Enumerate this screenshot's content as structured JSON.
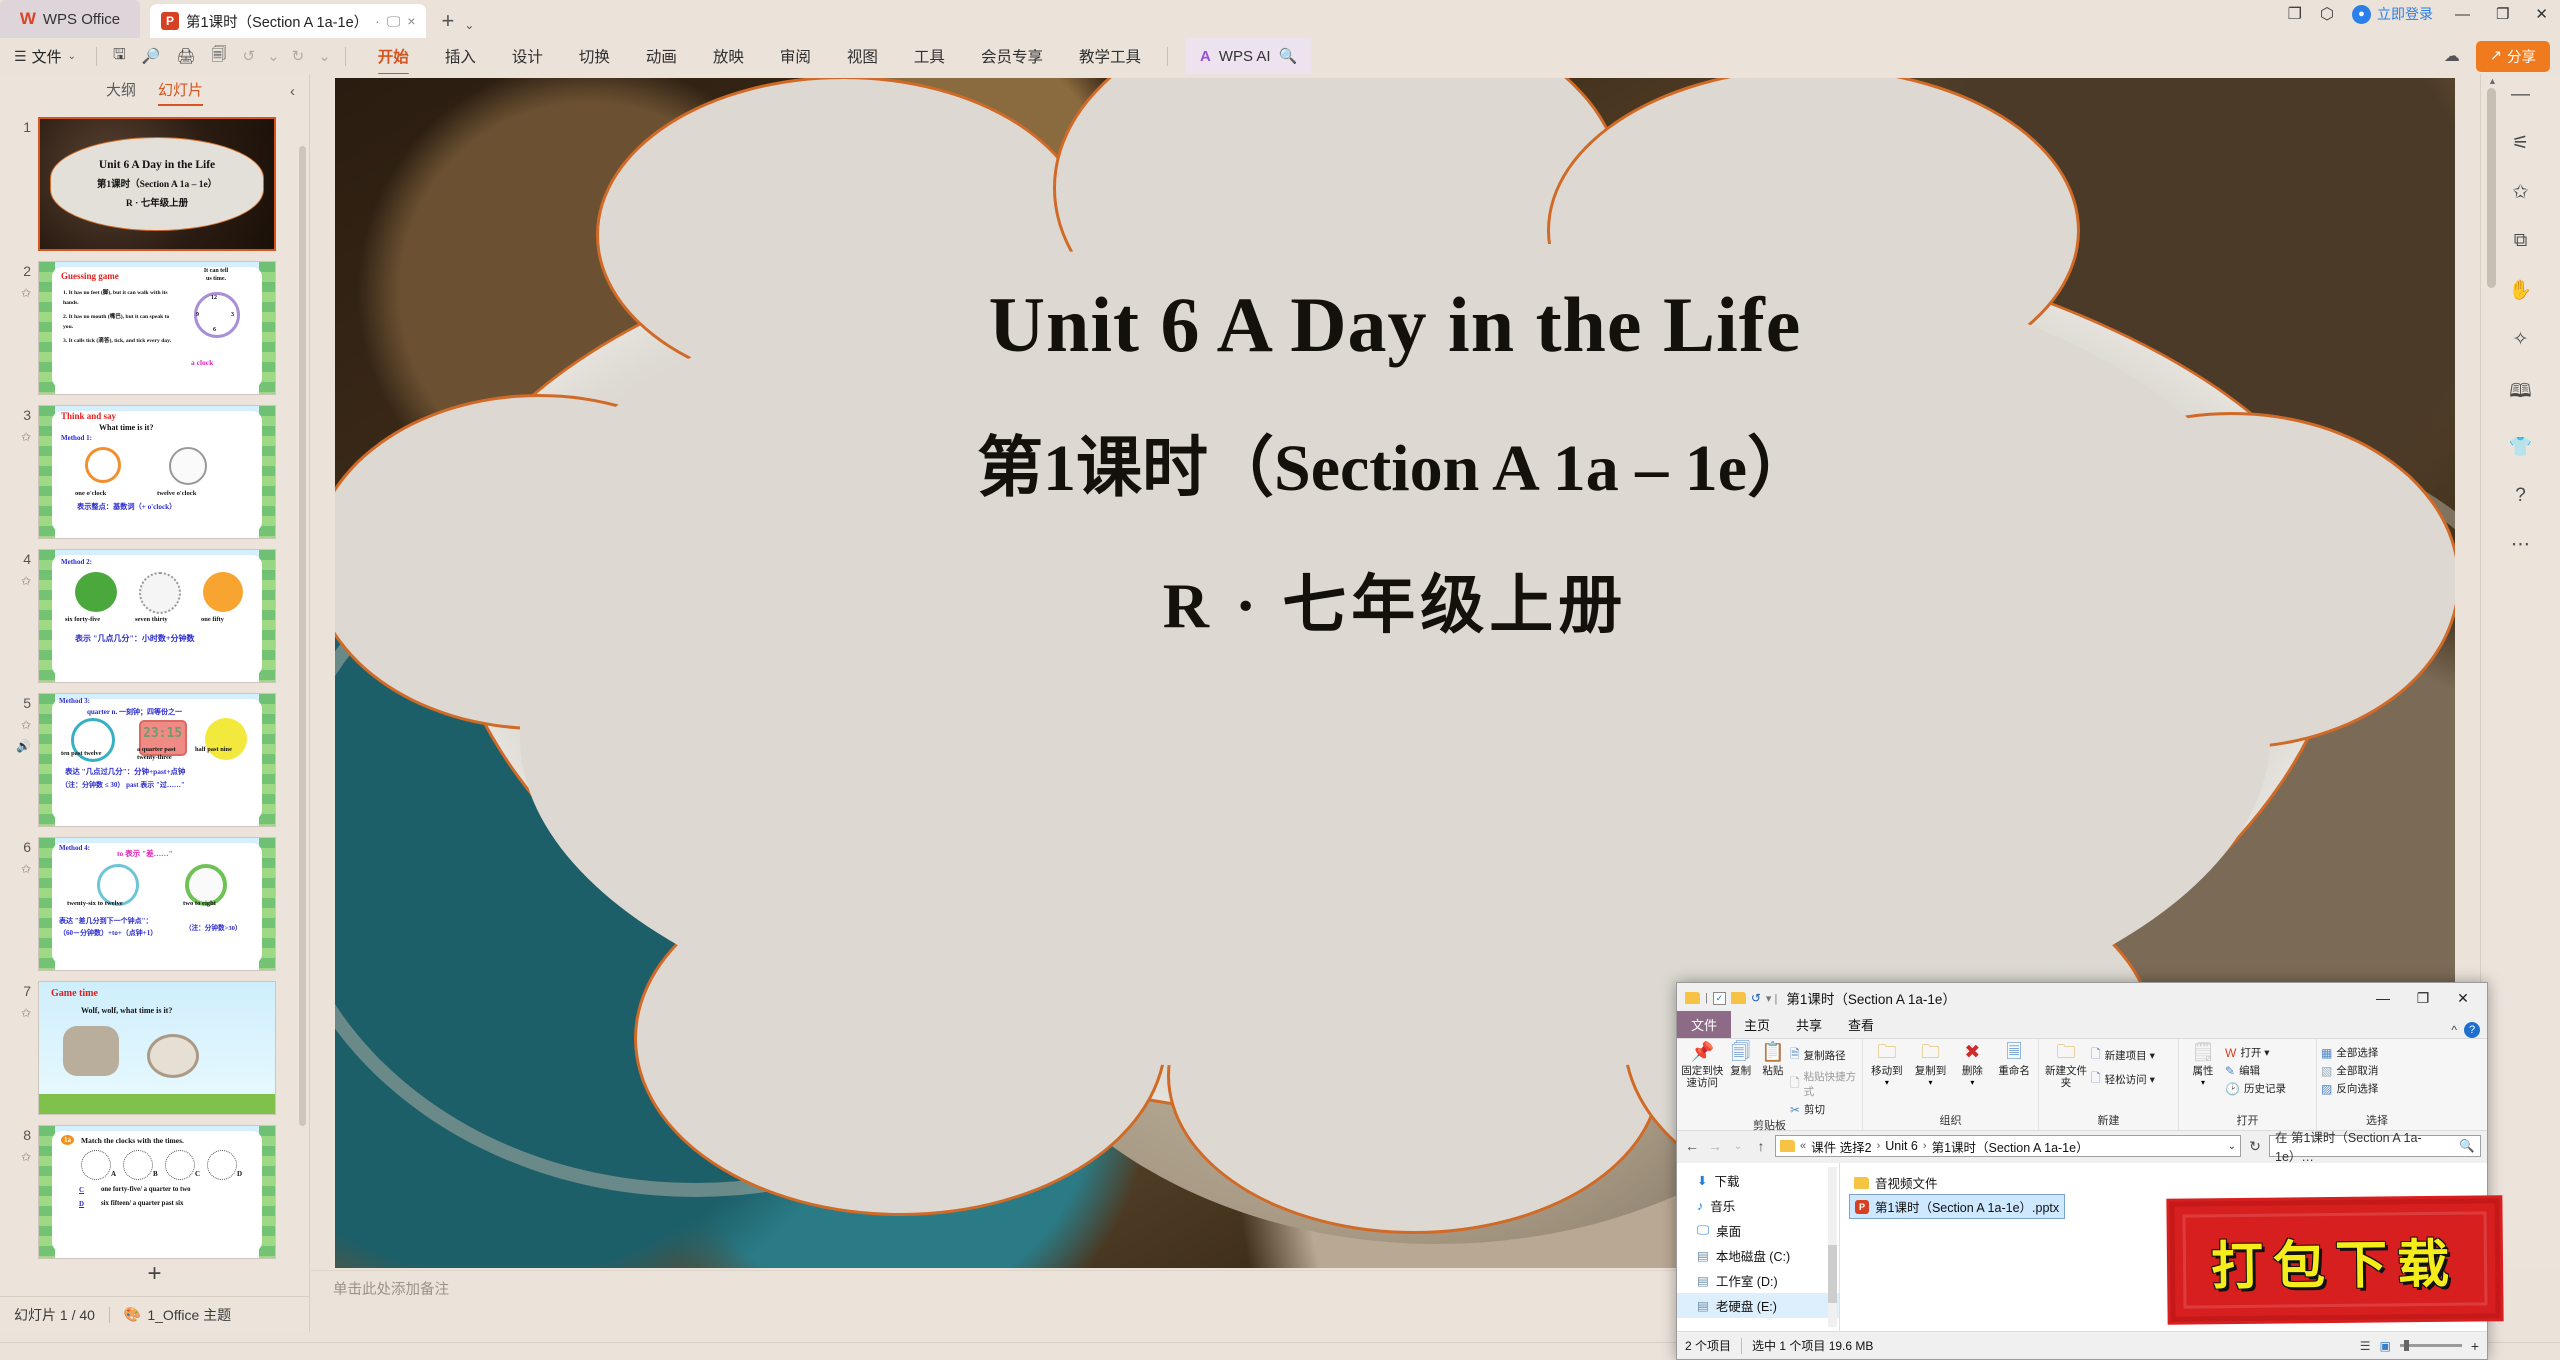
{
  "titlebar": {
    "brand": "WPS Office",
    "brand_logo": "wps-logo",
    "doc_tab": "第1课时（Section A 1a-1e）",
    "doc_tab_icon": "powerpoint-icon",
    "present_icon": "monitor-icon",
    "close_icon": "×",
    "new_tab_icon": "+",
    "tabs_dropdown_icon": "⌄",
    "right_icons": [
      "windows-icon",
      "box-icon"
    ],
    "login_label": "立即登录",
    "window_minimize": "—",
    "window_restore": "❐",
    "window_close": "✕"
  },
  "ribbon": {
    "file_label": "文件",
    "menu_icon": "hamburger-icon",
    "quick_access": [
      "save-icon",
      "search-doc-icon",
      "print-icon",
      "print-preview-icon",
      "undo-icon",
      "redo-icon",
      "customize-icon"
    ],
    "tabs": [
      "开始",
      "插入",
      "设计",
      "切换",
      "动画",
      "放映",
      "审阅",
      "视图",
      "工具",
      "会员专享",
      "教学工具"
    ],
    "active_tab": "开始",
    "ai_label": "WPS AI",
    "search_icon": "search-icon",
    "cloud_icon": "cloud-upload-icon",
    "share_label": "分享",
    "share_color": "#f07b1e",
    "accent_color": "#d4551f"
  },
  "left_panel": {
    "tabs": [
      "大纲",
      "幻灯片"
    ],
    "active_tab": "幻灯片",
    "collapse_icon": "chevron-left-icon",
    "add_slide_icon": "+",
    "slides": [
      {
        "number": "1",
        "selected": true,
        "type": "title",
        "lines": [
          "Unit 6 A Day in the Life",
          "第1课时（Section A 1a – 1e）",
          "R · 七年级上册"
        ]
      },
      {
        "number": "2",
        "selected": false,
        "type": "guessing",
        "heading": "Guessing game",
        "bubble": [
          "It can tell",
          "us time."
        ],
        "items": [
          "1. It has no feet (脚), but it can walk with its hands.",
          "2. It has no mouth (嘴巴), but it can speak to you.",
          "3. It calls tick (滴答), tick, and tick every day."
        ],
        "answer": "a clock",
        "clock_numbers": [
          "12",
          "3",
          "6",
          "9"
        ]
      },
      {
        "number": "3",
        "selected": false,
        "type": "method",
        "heading": "Think and say",
        "question": "What time is it?",
        "method": "Method 1:",
        "captions": [
          "one o'clock",
          "twelve o'clock"
        ],
        "rule": "表示整点：基数词（+ o'clock）"
      },
      {
        "number": "4",
        "selected": false,
        "type": "method",
        "method": "Method 2:",
        "captions": [
          "six forty-five",
          "seven thirty",
          "one fifty"
        ],
        "rule": "表示 \"几点几分\"：小时数+分钟数"
      },
      {
        "number": "5",
        "selected": false,
        "type": "method",
        "method": "Method 3:",
        "note": "quarter n. 一刻钟；四等份之一",
        "captions": [
          "ten past twelve",
          "a quarter past twenty-three",
          "half past nine"
        ],
        "digital": "23:15",
        "rule": "表达 \"几点过几分\"：分钟+past+点钟",
        "rule2": "（注：分钟数 ≤ 30） past 表示 \"过……\"",
        "has_audio": true
      },
      {
        "number": "6",
        "selected": false,
        "type": "method",
        "method": "Method 4:",
        "note": "to 表示 \"差……\"",
        "captions": [
          "twenty-six to twelve",
          "two to eight"
        ],
        "rule": "表达 \"差几分到下一个钟点\"：",
        "rule2": "（60－分钟数）+to+（点钟+1）",
        "rule3": "（注：分钟数>30）"
      },
      {
        "number": "7",
        "selected": false,
        "type": "game",
        "heading": "Game time",
        "question": "Wolf, wolf, what time is it?"
      },
      {
        "number": "8",
        "selected": false,
        "type": "exercise",
        "badge": "1a",
        "heading": "Match the clocks with the times.",
        "labels": [
          "A",
          "B",
          "C",
          "D"
        ],
        "rows": [
          {
            "answer": "C",
            "text": "one forty-five/ a quarter to two"
          },
          {
            "answer": "D",
            "text": "six fifteen/ a quarter past six"
          }
        ]
      }
    ],
    "status": {
      "slide_counter": "幻灯片 1 / 40",
      "theme_icon": "theme-icon",
      "theme_name": "1_Office 主题"
    }
  },
  "slide": {
    "title_en": "Unit 6 A Day in the Life",
    "title_cn": "第1课时（Section A 1a – 1e）",
    "subtitle": "R · 七年级上册",
    "cloud_border_color": "#d06a26"
  },
  "notes": {
    "placeholder": "单击此处添加备注"
  },
  "rail": {
    "icons": [
      "minimize-rail-icon",
      "adjust-icon",
      "favorite-icon",
      "shape-icon",
      "hand-tools-icon",
      "magic-wand-icon",
      "read-check-icon",
      "dress-theme-icon",
      "help-icon",
      "more-icon"
    ]
  },
  "explorer": {
    "title": "第1课时（Section A 1a-1e）",
    "qat": [
      "folder-icon",
      "properties-icon",
      "new-folder-icon",
      "undo-icon",
      "qat-caret"
    ],
    "window_buttons": {
      "minimize": "—",
      "maximize": "❐",
      "close": "✕"
    },
    "menus": [
      "文件",
      "主页",
      "共享",
      "查看"
    ],
    "active_menu": "主页",
    "help_caret": "^",
    "help_icon": "help-icon",
    "ribbon_groups": [
      {
        "title": "剪贴板",
        "big": [
          {
            "icon": "pin-icon",
            "label": "固定到快速访问"
          },
          {
            "icon": "copy-icon",
            "label": "复制"
          },
          {
            "icon": "paste-icon",
            "label": "粘贴"
          }
        ],
        "small": [
          {
            "icon": "copy-path-icon",
            "label": "复制路径",
            "dim": false
          },
          {
            "icon": "paste-shortcut-icon",
            "label": "粘贴快捷方式",
            "dim": true
          },
          {
            "icon": "cut-icon",
            "label": "剪切",
            "dim": false
          }
        ]
      },
      {
        "title": "组织",
        "big": [
          {
            "icon": "move-to-icon",
            "label": "移动到"
          },
          {
            "icon": "copy-to-icon",
            "label": "复制到"
          },
          {
            "icon": "delete-icon",
            "label": "删除"
          },
          {
            "icon": "rename-icon",
            "label": "重命名"
          }
        ],
        "small": []
      },
      {
        "title": "新建",
        "big": [
          {
            "icon": "new-folder-icon",
            "label": "新建文件夹"
          }
        ],
        "small": [
          {
            "icon": "new-item-icon",
            "label": "新建项目 ▾",
            "dim": false
          },
          {
            "icon": "easy-access-icon",
            "label": "轻松访问 ▾",
            "dim": false
          }
        ]
      },
      {
        "title": "打开",
        "big": [
          {
            "icon": "properties-icon",
            "label": "属性"
          }
        ],
        "small": [
          {
            "icon": "open-wps-icon",
            "label": "打开 ▾",
            "dim": false
          },
          {
            "icon": "edit-icon",
            "label": "编辑",
            "dim": false
          },
          {
            "icon": "history-icon",
            "label": "历史记录",
            "dim": false
          }
        ]
      },
      {
        "title": "选择",
        "big": [],
        "small": [
          {
            "icon": "select-all-icon",
            "label": "全部选择",
            "dim": false
          },
          {
            "icon": "select-none-icon",
            "label": "全部取消",
            "dim": false
          },
          {
            "icon": "invert-selection-icon",
            "label": "反向选择",
            "dim": false
          }
        ]
      }
    ],
    "address": {
      "back_icon": "←",
      "forward_icon": "→",
      "recent_icon": "⌄",
      "up_icon": "↑",
      "crumbs": [
        "课件 选择2",
        "Unit 6",
        "第1课时（Section A 1a-1e）"
      ],
      "crumb_prefix": "«",
      "dropdown_icon": "⌄",
      "refresh_icon": "↻",
      "search_placeholder": "在 第1课时（Section A 1a-1e）…",
      "search_icon": "search-icon"
    },
    "nav_items": [
      {
        "icon": "download-icon",
        "label": "下载",
        "selected": false
      },
      {
        "icon": "music-icon",
        "label": "音乐",
        "selected": false
      },
      {
        "icon": "desktop-icon",
        "label": "桌面",
        "selected": false
      },
      {
        "icon": "disk-icon",
        "label": "本地磁盘 (C:)",
        "selected": false
      },
      {
        "icon": "disk-icon",
        "label": "工作室 (D:)",
        "selected": false
      },
      {
        "icon": "disk-icon",
        "label": "老硬盘 (E:)",
        "selected": true
      }
    ],
    "files": [
      {
        "icon": "folder-icon",
        "name": "音视频文件",
        "selected": false
      },
      {
        "icon": "powerpoint-icon",
        "name": "第1课时（Section A 1a-1e）.pptx",
        "selected": true
      }
    ],
    "status": {
      "count": "2 个项目",
      "selection": "选中 1 个项目  19.6 MB",
      "view_details_icon": "details-view-icon",
      "view_tiles_icon": "tiles-view-icon"
    }
  },
  "stamp": {
    "text": "打包下载",
    "bg": "#d81f1f",
    "fg": "#f5ec1c"
  }
}
